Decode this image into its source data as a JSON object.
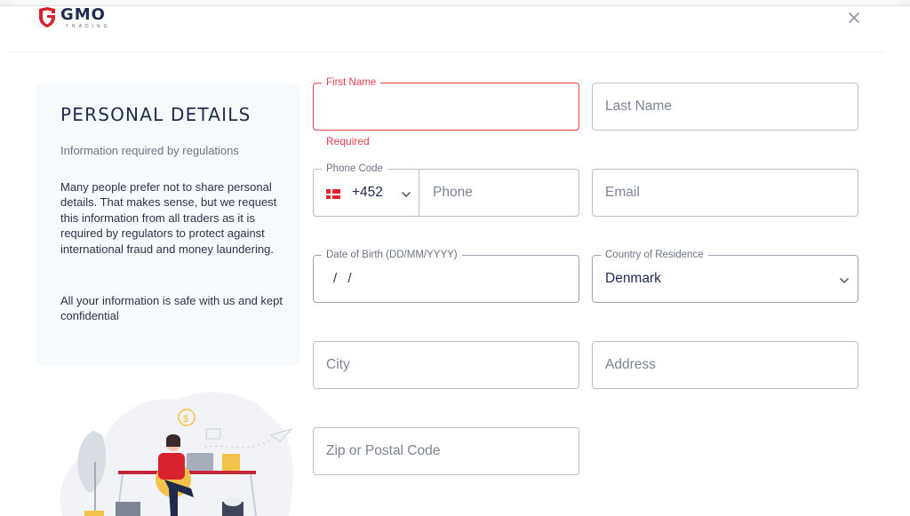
{
  "header": {
    "logo_name": "GMO",
    "logo_subtitle": "TRADING",
    "close_label": "close"
  },
  "info_panel": {
    "title": "PERSONAL DETAILS",
    "subtitle": "Information required by regulations",
    "body": "Many people prefer not to share personal details. That makes sense, but we request this information from all traders as it is required by regulators to protect against international fraud and money laundering.",
    "body2": "All your information is safe with us and kept confidential",
    "illustration": "person-at-desk-with-laptop-illustration"
  },
  "form": {
    "first_name": {
      "label": "First Name",
      "value": "",
      "error": "Required"
    },
    "last_name": {
      "placeholder": "Last Name",
      "value": ""
    },
    "phone_code": {
      "label": "Phone Code",
      "value": "+452",
      "flag": "denmark-flag"
    },
    "phone": {
      "placeholder": "Phone",
      "value": ""
    },
    "email": {
      "placeholder": "Email",
      "value": ""
    },
    "date_of_birth": {
      "label": "Date of Birth (DD/MM/YYYY)",
      "mask": "/ /"
    },
    "country": {
      "label": "Country of Residence",
      "value": "Denmark"
    },
    "city": {
      "placeholder": "City",
      "value": ""
    },
    "address": {
      "placeholder": "Address",
      "value": ""
    },
    "zip": {
      "placeholder": "Zip or Postal Code",
      "value": ""
    }
  },
  "colors": {
    "error": "#e8424f",
    "brand_red": "#d8232f",
    "brand_navy": "#1f2a4d",
    "border": "#b9c1cf"
  }
}
